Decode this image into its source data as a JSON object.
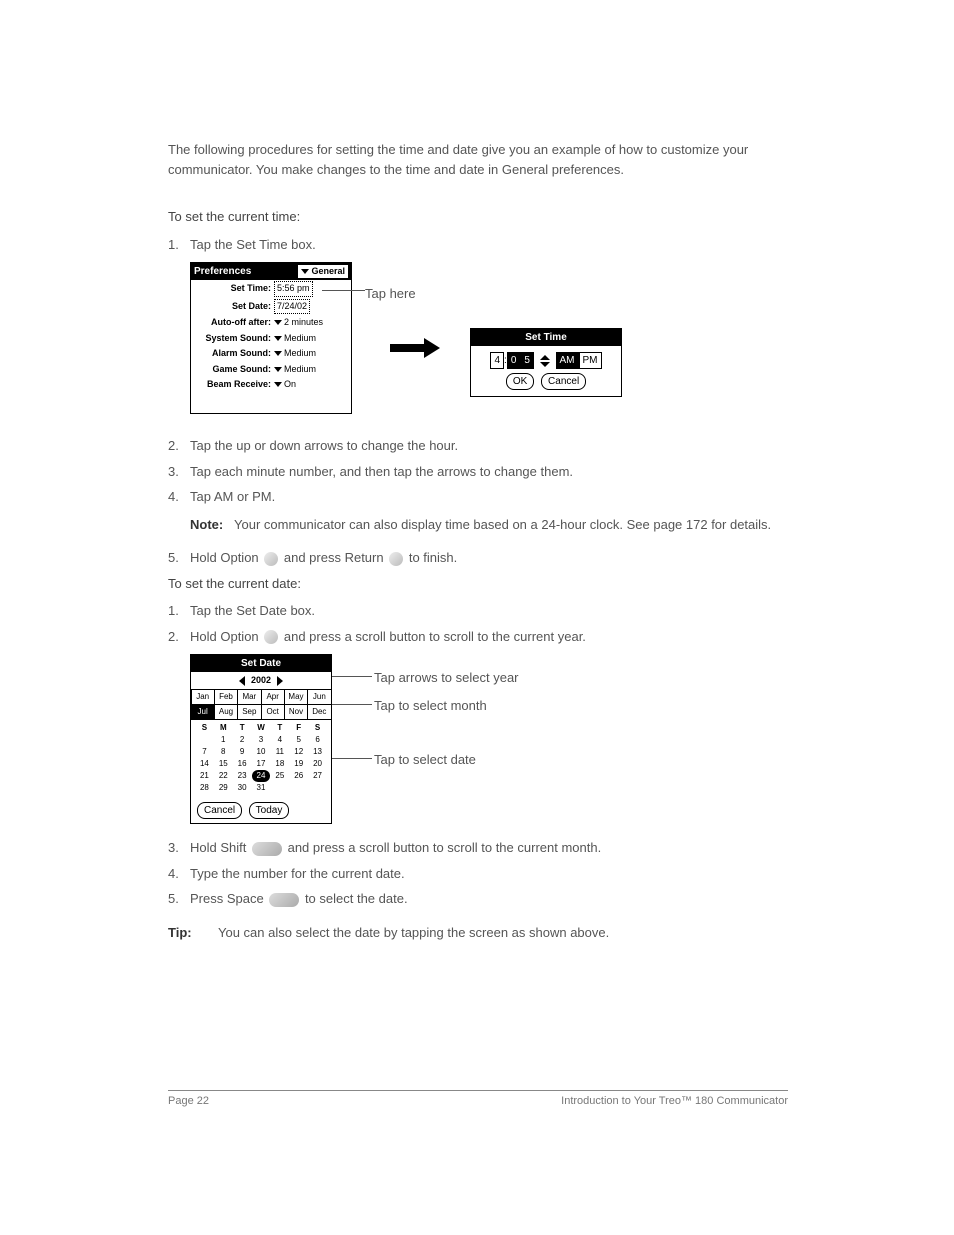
{
  "intro": "The following procedures for setting the time and date give you an example of how to customize your communicator. You make changes to the time and date in General preferences.",
  "headings": {
    "time": "To set the current time:",
    "date": "To set the current date:"
  },
  "time_steps": {
    "s1_num": "1.",
    "s1_txt": "Tap the Set Time box.",
    "s2_num": "2.",
    "s2_txt": "Tap the up or down arrows to change the hour.",
    "s3_num": "3.",
    "s3_txt": "Tap each minute number, and then tap the arrows to change them.",
    "s4_num": "4.",
    "s4_txt": "Tap AM or PM.",
    "note_lbl": "Note:",
    "note_txt": "Your communicator can also display time based on a 24-hour clock. See page 172 for details.",
    "s5_num": "5.",
    "s5_pre": "Hold Option ",
    "s5_mid": " and press Return ",
    "s5_post": " to finish."
  },
  "date_steps": {
    "s1_num": "1.",
    "s1_txt": "Tap the Set Date box.",
    "s2_num": "2.",
    "s2_pre": "Hold Option ",
    "s2_post": " and press a scroll button to scroll to the current year.",
    "s3_num": "3.",
    "s3_pre": "Hold Shift ",
    "s3_post": " and press a scroll button to scroll to the current month.",
    "s4_num": "4.",
    "s4_txt": "Type the number for the current date.",
    "s5_num": "5.",
    "s5_pre": "Press Space ",
    "s5_post": " to select the date."
  },
  "tip": {
    "lbl": "Tip:",
    "txt": "You can also select the date by tapping the screen as shown above."
  },
  "fig1": {
    "prefs_title": "Preferences",
    "general": "General",
    "set_time_lbl": "Set Time:",
    "set_time_val": "5:56 pm",
    "set_date_lbl": "Set Date:",
    "set_date_val": "7/24/02",
    "auto_off_lbl": "Auto-off after:",
    "auto_off_val": "2 minutes",
    "sys_sound_lbl": "System Sound:",
    "sys_sound_val": "Medium",
    "alarm_sound_lbl": "Alarm Sound:",
    "alarm_sound_val": "Medium",
    "game_sound_lbl": "Game Sound:",
    "game_sound_val": "Medium",
    "beam_lbl": "Beam Receive:",
    "beam_val": "On",
    "callout": "Tap here",
    "st_title": "Set Time",
    "st_hour": "4",
    "st_m1": "0",
    "st_m2": "5",
    "st_am": "AM",
    "st_pm": "PM",
    "ok": "OK",
    "cancel": "Cancel"
  },
  "fig2": {
    "title": "Set Date",
    "year": "2002",
    "months": [
      "Jan",
      "Feb",
      "Mar",
      "Apr",
      "May",
      "Jun",
      "Jul",
      "Aug",
      "Sep",
      "Oct",
      "Nov",
      "Dec"
    ],
    "selected_month_index": 6,
    "dow": [
      "S",
      "M",
      "T",
      "W",
      "T",
      "F",
      "S"
    ],
    "weeks": [
      [
        "",
        "1",
        "2",
        "3",
        "4",
        "5",
        "6"
      ],
      [
        "7",
        "8",
        "9",
        "10",
        "11",
        "12",
        "13"
      ],
      [
        "14",
        "15",
        "16",
        "17",
        "18",
        "19",
        "20"
      ],
      [
        "21",
        "22",
        "23",
        "24",
        "25",
        "26",
        "27"
      ],
      [
        "28",
        "29",
        "30",
        "31",
        "",
        "",
        ""
      ]
    ],
    "selected_day": "24",
    "cancel": "Cancel",
    "today": "Today",
    "c1": "Tap arrows to select year",
    "c2": "Tap to select month",
    "c3": "Tap to select date"
  },
  "footer": {
    "left": "Page 22",
    "right": "Introduction to Your Treo™ 180 Communicator"
  }
}
